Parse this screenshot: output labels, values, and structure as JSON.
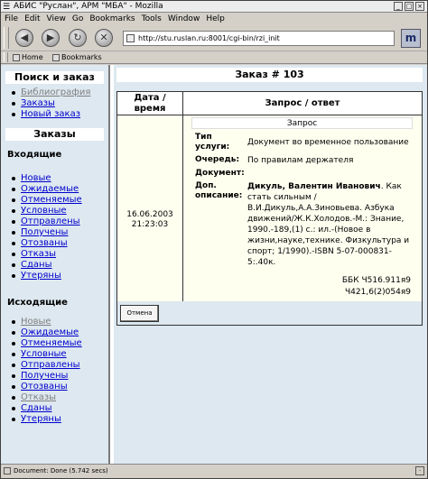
{
  "window": {
    "title": "АБИС \"Руслан\", АРМ \"МБА\" - Mozilla"
  },
  "menu": [
    "File",
    "Edit",
    "View",
    "Go",
    "Bookmarks",
    "Tools",
    "Window",
    "Help"
  ],
  "url": "http://stu.ruslan.ru:8001/cgi-bin/rzi_init",
  "bookmarks": {
    "home": "Home",
    "bookmarks": "Bookmarks"
  },
  "sidebar": {
    "search_title": "Поиск и заказ",
    "search_links": [
      {
        "label": "Библиография",
        "visited": true
      },
      {
        "label": "Заказы",
        "visited": false
      },
      {
        "label": "Новый заказ",
        "visited": false
      }
    ],
    "orders_title": "Заказы",
    "incoming_title": "Входящие",
    "incoming": [
      "Новые",
      "Ожидаемые",
      "Отменяемые",
      "Условные",
      "Отправлены",
      "Получены",
      "Отозваны",
      "Отказы",
      "Сданы",
      "Утеряны"
    ],
    "outgoing_title": "Исходящие",
    "outgoing": [
      {
        "label": "Новые",
        "visited": true
      },
      {
        "label": "Ожидаемые",
        "visited": false
      },
      {
        "label": "Отменяемые",
        "visited": false
      },
      {
        "label": "Условные",
        "visited": false
      },
      {
        "label": "Отправлены",
        "visited": false
      },
      {
        "label": "Получены",
        "visited": false
      },
      {
        "label": "Отозваны",
        "visited": false
      },
      {
        "label": "Отказы",
        "visited": true
      },
      {
        "label": "Сданы",
        "visited": false
      },
      {
        "label": "Утеряны",
        "visited": false
      }
    ]
  },
  "main": {
    "title": "Заказ # 103",
    "col_date": "Дата / время",
    "col_req": "Запрос / ответ",
    "date": "16.06.2003",
    "time": "21:23:03",
    "req_header": "Запрос",
    "service_label": "Тип услуги:",
    "service_value": "Документ во временное пользование",
    "queue_label": "Очередь:",
    "queue_value": "По правилам держателя",
    "document_label": "Документ:",
    "desc_label": "Доп. описание:",
    "desc_author": "Дикуль, Валентин Иванович",
    "desc_text": ". Как стать сильным / В.И.Дикуль,А.А.Зиновьева. Азбука движений/Ж.К.Холодов.-М.: Знание, 1990.-189,(1) с.: ил.-(Новое в жизни,науке,технике. Физкультура и спорт; 1/1990).-ISBN 5-07-000831-5:.40к.",
    "bbk": "ББК Ч516.911я9",
    "bbk2": "Ч421,6(2)054я9",
    "cancel": "Отмена"
  },
  "status": "Document: Done (5.742 secs)"
}
